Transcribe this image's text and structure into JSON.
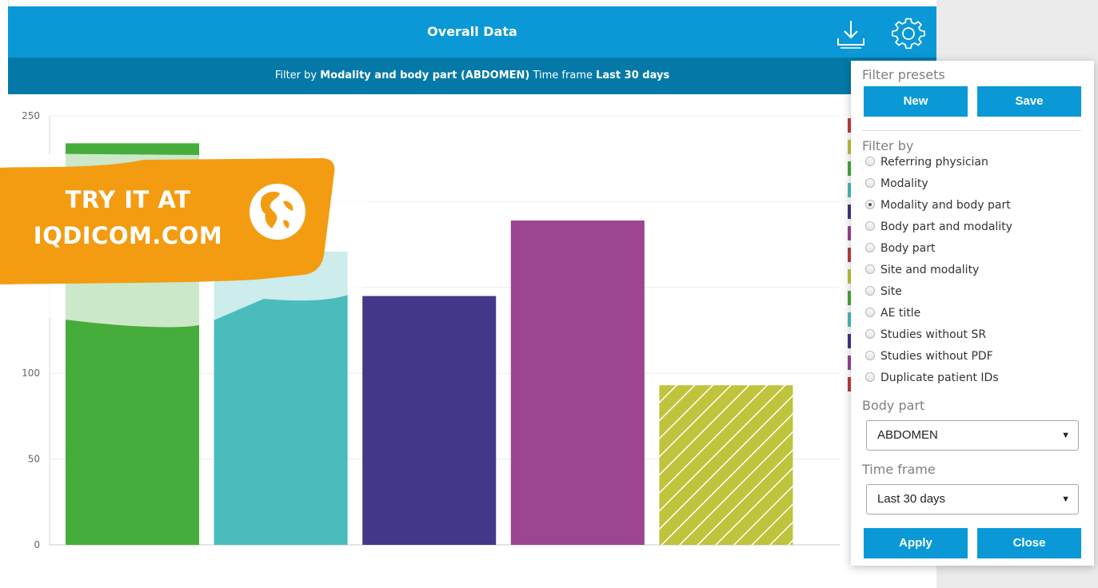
{
  "header": {
    "title": "Overall Data",
    "download_icon": "download-icon",
    "settings_icon": "gear-icon"
  },
  "subheader": {
    "prefix": "Filter by",
    "filter_value": "Modality and body part (ABDOMEN)",
    "timeframe_label": "Time frame",
    "timeframe_value": "Last 30 days"
  },
  "promo": {
    "line1": "TRY IT AT",
    "line2": "IQDICOM.COM",
    "icon": "globe-icon"
  },
  "filter_panel": {
    "presets_label": "Filter presets",
    "new_label": "New",
    "save_label": "Save",
    "filter_by_label": "Filter by",
    "options": [
      {
        "label": "Referring physician",
        "checked": false
      },
      {
        "label": "Modality",
        "checked": false
      },
      {
        "label": "Modality and body part",
        "checked": true
      },
      {
        "label": "Body part and modality",
        "checked": false
      },
      {
        "label": "Body part",
        "checked": false
      },
      {
        "label": "Site and modality",
        "checked": false
      },
      {
        "label": "Site",
        "checked": false
      },
      {
        "label": "AE title",
        "checked": false
      },
      {
        "label": "Studies without SR",
        "checked": false
      },
      {
        "label": "Studies without PDF",
        "checked": false
      },
      {
        "label": "Duplicate patient IDs",
        "checked": false
      }
    ],
    "body_part_label": "Body part",
    "body_part_value": "ABDOMEN",
    "time_frame_label": "Time frame",
    "time_frame_value": "Last 30 days",
    "apply_label": "Apply",
    "close_label": "Close"
  },
  "colors": {
    "header": "#0a99d6",
    "subheader": "#0479a8",
    "promo": "#f39c12",
    "button": "#0a99d6"
  },
  "chart_data": {
    "type": "bar",
    "title": "",
    "xlabel": "",
    "ylabel": "",
    "ylim": [
      0,
      250
    ],
    "yticks": [
      0,
      50,
      100,
      250
    ],
    "grid": true,
    "values": [
      234,
      171,
      145,
      189,
      93
    ],
    "colors": [
      "#46ac3b",
      "#4bbcbc",
      "#423789",
      "#9c4591",
      "#c0c33c"
    ],
    "hatched": [
      false,
      false,
      false,
      false,
      true
    ],
    "legend_swatch_colors": [
      "#c23b3b",
      "#c0c33c",
      "#46ac3b",
      "#4bbcbc",
      "#423789",
      "#9c4591",
      "#c23b3b",
      "#c0c33c",
      "#46ac3b",
      "#4bbcbc",
      "#423789",
      "#9c4591",
      "#c23b3b"
    ]
  }
}
